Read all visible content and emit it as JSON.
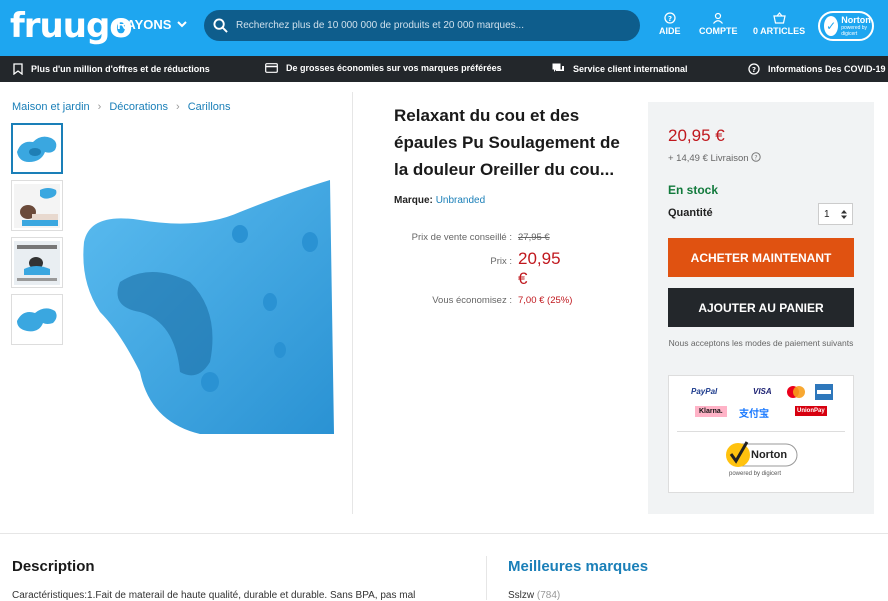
{
  "header": {
    "logo": "fruugo",
    "rayons": "RAYONS",
    "search_placeholder": "Recherchez plus de 10 000 000 de produits et 20 000 marques...",
    "aide": "AIDE",
    "compte": "COMPTE",
    "articles": "0 ARTICLES",
    "norton": "Norton",
    "norton_sub": "powered by digicert"
  },
  "infobar": [
    {
      "label": "Plus d'un million d'offres et de réductions",
      "icon": "bookmark-icon"
    },
    {
      "label": "De grosses économies sur vos marques préférées",
      "icon": "card-icon"
    },
    {
      "label": "Service client international",
      "icon": "chat-icon"
    },
    {
      "label": "Informations Des COVID-19",
      "icon": "help-circle-icon"
    }
  ],
  "breadcrumb": [
    "Maison et jardin",
    "Décorations",
    "Carillons"
  ],
  "product": {
    "title": "Relaxant du cou et des épaules Pu Soulagement de la douleur Oreiller du cou...",
    "brand_label": "Marque:",
    "brand": "Unbranded",
    "rrp_label": "Prix de vente conseillé :",
    "rrp": "27,95 €",
    "price_label": "Prix :",
    "price": "20,95 €",
    "save_label": "Vous économisez :",
    "save": "7,00 € (25%)"
  },
  "buybox": {
    "price": "20,95 €",
    "delivery": "+ 14,49 € Livraison",
    "stock": "En stock",
    "qty_label": "Quantité",
    "qty": "1",
    "buy_now": "ACHETER MAINTENANT",
    "add_cart": "AJOUTER AU PANIER",
    "payment_note": "Nous acceptons les modes de paiement suivants",
    "payments": [
      "PayPal",
      "VISA",
      "Klarna.",
      "支付宝",
      "UnionPay"
    ],
    "norton": "Norton",
    "norton_sub": "powered by digicert"
  },
  "description": {
    "heading": "Description",
    "text": "Caractéristiques:1.Fait de materail de haute qualité, durable et durable. Sans BPA, pas mal"
  },
  "brands": {
    "heading": "Meilleures marques",
    "first": "Sslzw",
    "first_count": "(784)"
  },
  "colors": {
    "brand_blue": "#1ea6f0",
    "dark_bar": "#23272b",
    "buy_orange": "#e05211",
    "price_red": "#c0181e",
    "stock_green": "#127a3c"
  }
}
